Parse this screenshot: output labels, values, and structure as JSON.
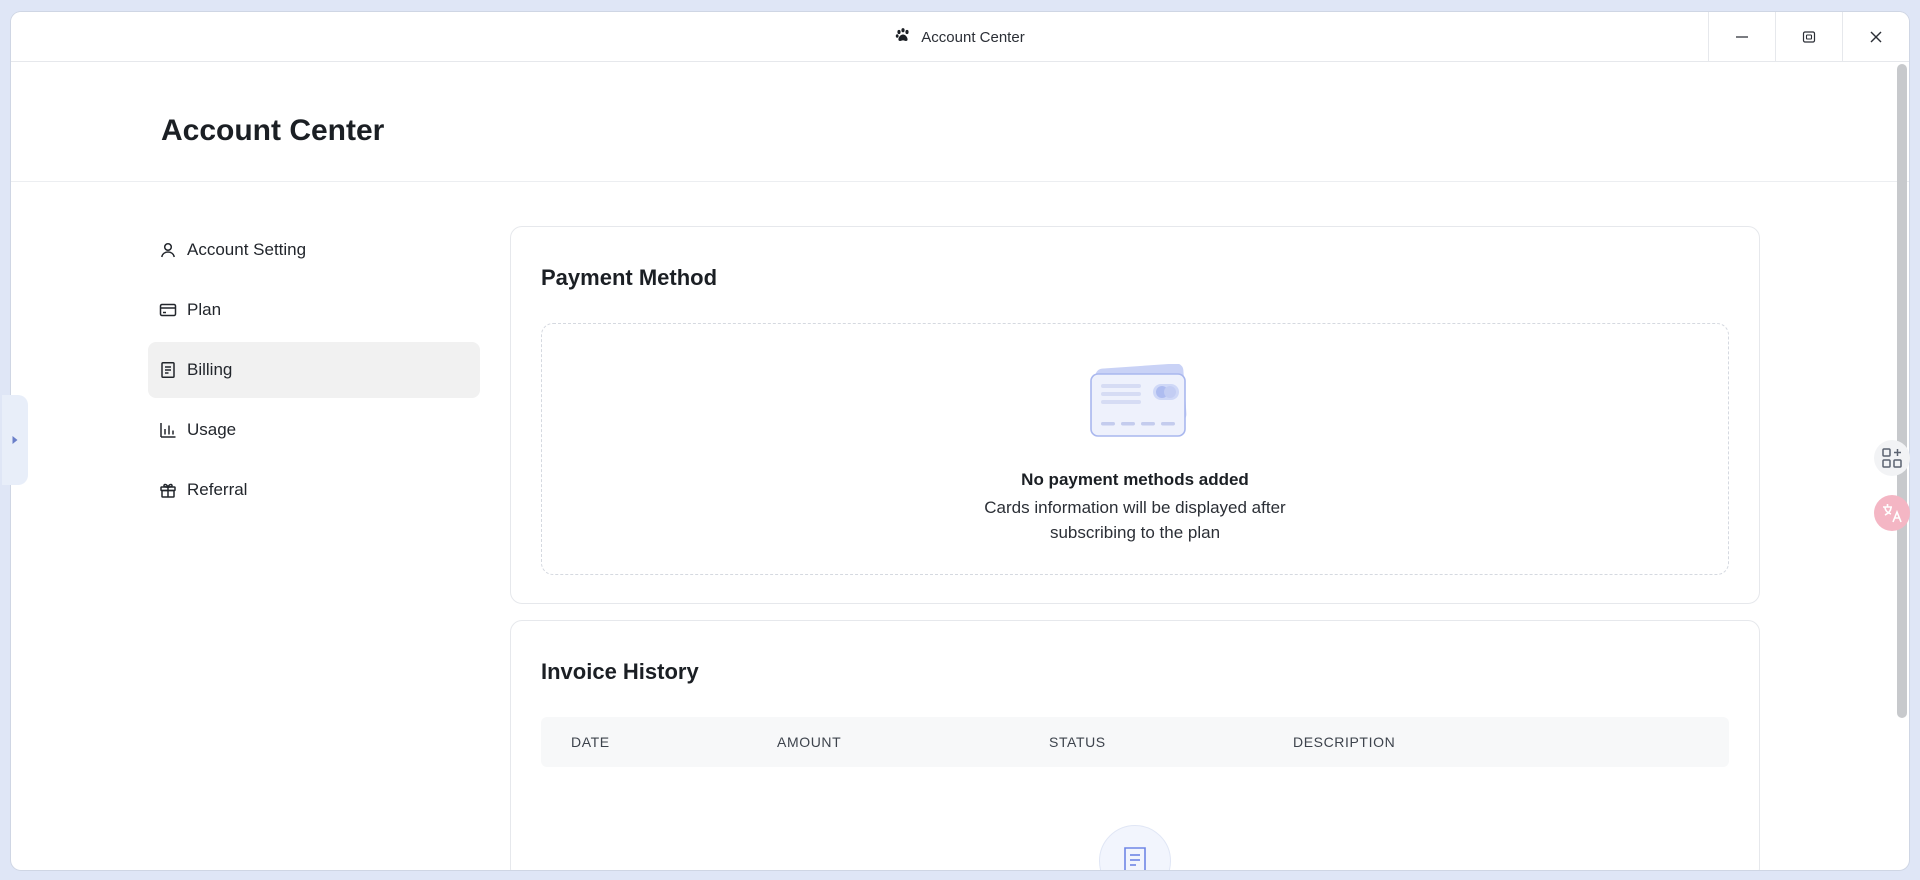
{
  "window": {
    "title": "Account Center"
  },
  "header": {
    "title": "Account Center"
  },
  "sidebar": {
    "items": [
      {
        "label": "Account Setting",
        "icon": "user-icon"
      },
      {
        "label": "Plan",
        "icon": "credit-card-icon"
      },
      {
        "label": "Billing",
        "icon": "receipt-icon",
        "active": true
      },
      {
        "label": "Usage",
        "icon": "bar-chart-icon"
      },
      {
        "label": "Referral",
        "icon": "gift-icon"
      }
    ]
  },
  "payment": {
    "title": "Payment Method",
    "empty_title": "No payment methods added",
    "empty_desc_line1": "Cards information will be displayed after",
    "empty_desc_line2": "subscribing to the plan"
  },
  "invoice": {
    "title": "Invoice History",
    "columns": [
      "DATE",
      "AMOUNT",
      "STATUS",
      "DESCRIPTION"
    ]
  },
  "colors": {
    "desktop": "#dfe6f6",
    "active_nav": "#f1f1f1",
    "accent_blue": "#6f86e6",
    "translate_pink": "#f4b6c4"
  }
}
